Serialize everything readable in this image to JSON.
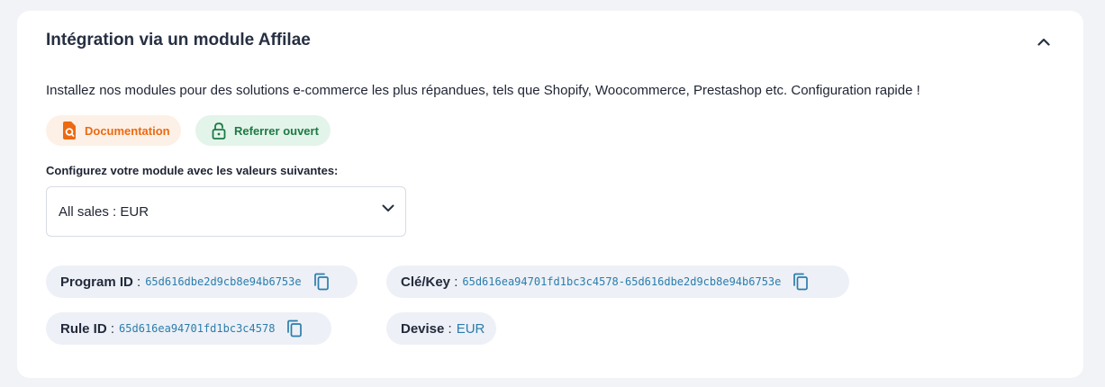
{
  "card": {
    "title": "Intégration via un module Affilae",
    "description": "Installez nos modules pour des solutions e-commerce les plus répandues, tels que Shopify, Woocommerce, Prestashop etc. Configuration rapide !",
    "collapse_icon": "chevron-up-icon"
  },
  "buttons": {
    "documentation": {
      "label": "Documentation",
      "icon": "document-search-icon",
      "color": "#ec6a12"
    },
    "referrer": {
      "label": "Referrer ouvert",
      "icon": "lock-open-icon",
      "color": "#1d7a45"
    }
  },
  "config": {
    "label": "Configurez votre module avec les valeurs suivantes:",
    "select_value": "All sales : EUR"
  },
  "fields": {
    "program_id": {
      "label": "Program ID",
      "sep": ":",
      "value": "65d616dbe2d9cb8e94b6753e"
    },
    "key": {
      "label": "Clé/Key",
      "sep": ":",
      "value": "65d616ea94701fd1bc3c4578-65d616dbe2d9cb8e94b6753e"
    },
    "rule_id": {
      "label": "Rule ID",
      "sep": ":",
      "value": "65d616ea94701fd1bc3c4578"
    },
    "devise": {
      "label": "Devise",
      "sep": ":",
      "value": "EUR"
    }
  },
  "colors": {
    "accent_value": "#2b7dac",
    "field_bg": "#edf0f6",
    "page_bg": "#f1f3f7"
  }
}
